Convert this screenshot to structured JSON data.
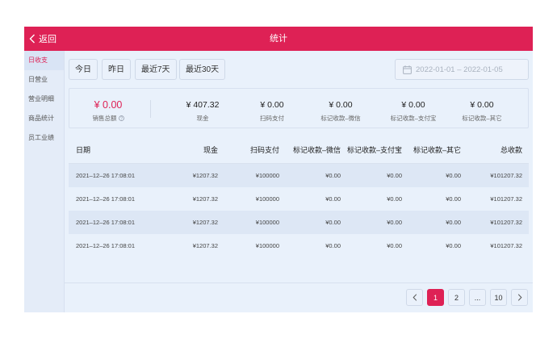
{
  "header": {
    "back_label": "返回",
    "title": "统计"
  },
  "sidebar": {
    "items": [
      {
        "label": "日收支",
        "active": true
      },
      {
        "label": "日营业",
        "active": false
      },
      {
        "label": "营业明细",
        "active": false
      },
      {
        "label": "商品统计",
        "active": false
      },
      {
        "label": "员工业绩",
        "active": false
      }
    ]
  },
  "filters": {
    "today": "今日",
    "yesterday": "昨日",
    "last7": "最近7天",
    "last30": "最近30天"
  },
  "date_range": {
    "icon": "calendar-icon",
    "value": "2022-01-01 – 2022-01-05"
  },
  "summary": {
    "total": {
      "value": "¥ 0.00",
      "label": "销售总额"
    },
    "cash": {
      "value": "¥ 407.32",
      "label": "现金"
    },
    "scan": {
      "value": "¥ 0.00",
      "label": "扫码支付"
    },
    "wechat": {
      "value": "¥ 0.00",
      "label": "标记收款–微信"
    },
    "alipay": {
      "value": "¥ 0.00",
      "label": "标记收款–支付宝"
    },
    "other": {
      "value": "¥ 0.00",
      "label": "标记收款–其它"
    }
  },
  "table": {
    "headers": {
      "date": "日期",
      "cash": "现金",
      "scan": "扫码支付",
      "wechat": "标记收款–微信",
      "alipay": "标记收款–支付宝",
      "other": "标记收款–其它",
      "total": "总收款"
    },
    "rows": [
      {
        "date": "2021–12–26 17:08:01",
        "cash": "¥1207.32",
        "scan": "¥100000",
        "wechat": "¥0.00",
        "alipay": "¥0.00",
        "other": "¥0.00",
        "total": "¥101207.32"
      },
      {
        "date": "2021–12–26 17:08:01",
        "cash": "¥1207.32",
        "scan": "¥100000",
        "wechat": "¥0.00",
        "alipay": "¥0.00",
        "other": "¥0.00",
        "total": "¥101207.32"
      },
      {
        "date": "2021–12–26 17:08:01",
        "cash": "¥1207.32",
        "scan": "¥100000",
        "wechat": "¥0.00",
        "alipay": "¥0.00",
        "other": "¥0.00",
        "total": "¥101207.32"
      },
      {
        "date": "2021–12–26 17:08:01",
        "cash": "¥1207.32",
        "scan": "¥100000",
        "wechat": "¥0.00",
        "alipay": "¥0.00",
        "other": "¥0.00",
        "total": "¥101207.32"
      }
    ]
  },
  "pagination": {
    "current": "1",
    "p2": "2",
    "ellipsis": "...",
    "last": "10"
  },
  "colors": {
    "accent": "#de2155",
    "background": "#e9f1fb"
  }
}
